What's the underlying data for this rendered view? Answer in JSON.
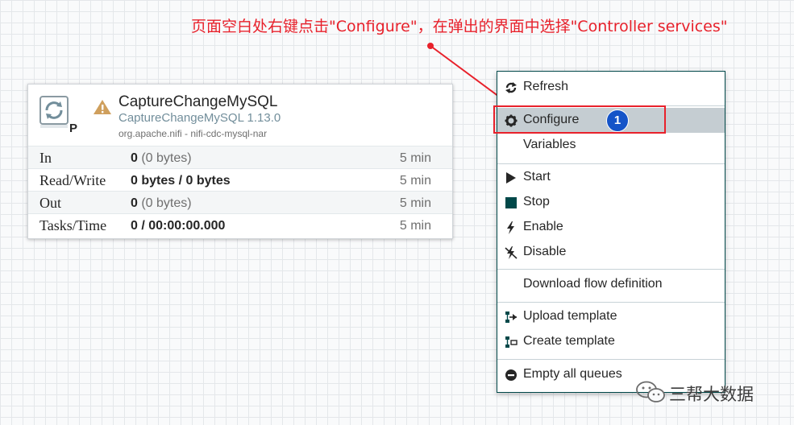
{
  "annotation": {
    "text": "页面空白处右键点击\"Configure\"，在弹出的界面中选择\"Controller services\"",
    "color": "#e8212b"
  },
  "processor": {
    "icon": "processor-icon",
    "badge": "P",
    "warning_icon": "warning-icon",
    "name": "CaptureChangeMySQL",
    "type": "CaptureChangeMySQL 1.13.0",
    "bundle": "org.apache.nifi - nifi-cdc-mysql-nar",
    "stats": [
      {
        "label": "In",
        "value_bold": "0",
        "value_rest": " (0 bytes)",
        "time": "5 min"
      },
      {
        "label": "Read/Write",
        "value_bold": "0 bytes / 0 bytes",
        "value_rest": "",
        "time": "5 min"
      },
      {
        "label": "Out",
        "value_bold": "0",
        "value_rest": " (0 bytes)",
        "time": "5 min"
      },
      {
        "label": "Tasks/Time",
        "value_bold": "0 / 00:00:00.000",
        "value_rest": "",
        "time": "5 min"
      }
    ]
  },
  "context_menu": {
    "items": [
      {
        "label": "Refresh",
        "icon": "refresh-icon"
      },
      {
        "label": "Configure",
        "icon": "gear-icon",
        "selected": true
      },
      {
        "label": "Variables",
        "icon": ""
      },
      {
        "label": "Start",
        "icon": "play-icon"
      },
      {
        "label": "Stop",
        "icon": "stop-icon"
      },
      {
        "label": "Enable",
        "icon": "lightning-icon"
      },
      {
        "label": "Disable",
        "icon": "disable-icon"
      },
      {
        "label": "Download flow definition",
        "icon": ""
      },
      {
        "label": "Upload template",
        "icon": "upload-template-icon"
      },
      {
        "label": "Create template",
        "icon": "create-template-icon"
      },
      {
        "label": "Empty all queues",
        "icon": "minus-circle-icon"
      }
    ]
  },
  "step_badge": "1",
  "watermark": {
    "text": "三帮大数据",
    "icon": "wechat-icon"
  }
}
